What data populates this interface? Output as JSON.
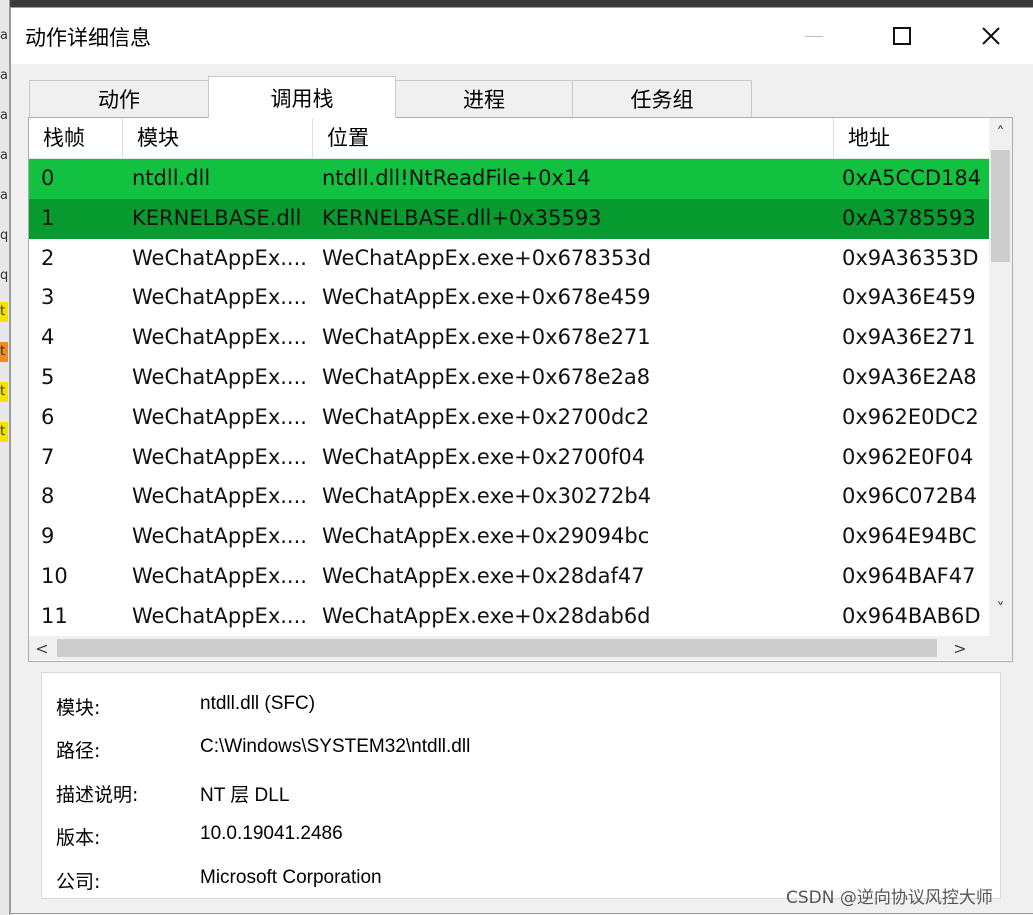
{
  "window": {
    "title": "动作详细信息",
    "controls": {
      "minimize": "—",
      "maximize": "□",
      "close": "✕"
    }
  },
  "tabs": [
    {
      "label": "动作",
      "active": false
    },
    {
      "label": "调用栈",
      "active": true
    },
    {
      "label": "进程",
      "active": false
    },
    {
      "label": "任务组",
      "active": false
    }
  ],
  "stack": {
    "columns": [
      "栈帧",
      "模块",
      "位置",
      "地址"
    ],
    "rows": [
      {
        "frame": "0",
        "module": "ntdll.dll",
        "location": "ntdll.dll!NtReadFile+0x14",
        "address": "0xA5CCD184",
        "highlight": "light"
      },
      {
        "frame": "1",
        "module": "KERNELBASE.dll",
        "location": "KERNELBASE.dll+0x35593",
        "address": "0xA3785593",
        "highlight": "dark"
      },
      {
        "frame": "2",
        "module": "WeChatAppEx....",
        "location": "WeChatAppEx.exe+0x678353d",
        "address": "0x9A36353D"
      },
      {
        "frame": "3",
        "module": "WeChatAppEx....",
        "location": "WeChatAppEx.exe+0x678e459",
        "address": "0x9A36E459"
      },
      {
        "frame": "4",
        "module": "WeChatAppEx....",
        "location": "WeChatAppEx.exe+0x678e271",
        "address": "0x9A36E271"
      },
      {
        "frame": "5",
        "module": "WeChatAppEx....",
        "location": "WeChatAppEx.exe+0x678e2a8",
        "address": "0x9A36E2A8"
      },
      {
        "frame": "6",
        "module": "WeChatAppEx....",
        "location": "WeChatAppEx.exe+0x2700dc2",
        "address": "0x962E0DC2"
      },
      {
        "frame": "7",
        "module": "WeChatAppEx....",
        "location": "WeChatAppEx.exe+0x2700f04",
        "address": "0x962E0F04"
      },
      {
        "frame": "8",
        "module": "WeChatAppEx....",
        "location": "WeChatAppEx.exe+0x30272b4",
        "address": "0x96C072B4"
      },
      {
        "frame": "9",
        "module": "WeChatAppEx....",
        "location": "WeChatAppEx.exe+0x29094bc",
        "address": "0x964E94BC"
      },
      {
        "frame": "10",
        "module": "WeChatAppEx....",
        "location": "WeChatAppEx.exe+0x28daf47",
        "address": "0x964BAF47"
      },
      {
        "frame": "11",
        "module": "WeChatAppEx....",
        "location": "WeChatAppEx.exe+0x28dab6d",
        "address": "0x964BAB6D"
      }
    ],
    "scroll": {
      "up": "˄",
      "down": "˅",
      "left": "<",
      "right": ">"
    }
  },
  "details": [
    {
      "label": "模块:",
      "value": "ntdll.dll (SFC)"
    },
    {
      "label": "路径:",
      "value": "C:\\Windows\\SYSTEM32\\ntdll.dll"
    },
    {
      "label": "描述说明:",
      "value": "NT 层 DLL"
    },
    {
      "label": "版本:",
      "value": "10.0.19041.2486"
    },
    {
      "label": "公司:",
      "value": "Microsoft Corporation"
    }
  ],
  "background_markers": [
    "a",
    "a",
    "a",
    "a",
    "a",
    "q",
    "q",
    "t",
    "t",
    "t",
    "t"
  ],
  "watermark": "CSDN @逆向协议风控大师",
  "colors": {
    "selected_light": "#12c13f",
    "selected_dark": "#079a2e"
  }
}
